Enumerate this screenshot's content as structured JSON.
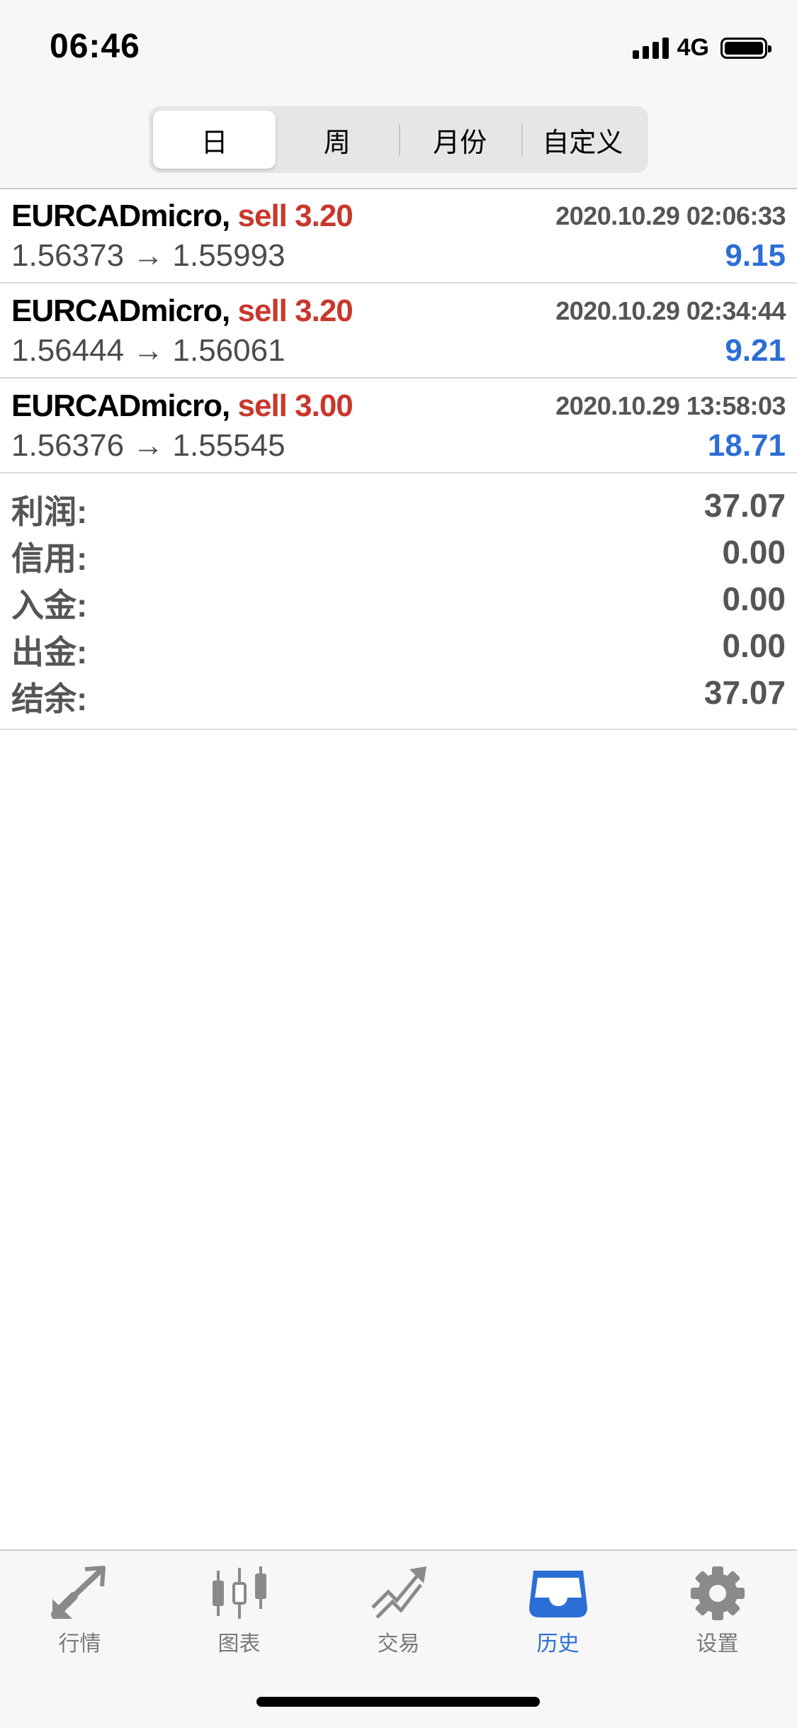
{
  "status": {
    "time": "06:46",
    "network": "4G"
  },
  "segments": [
    {
      "label": "日",
      "active": true
    },
    {
      "label": "周",
      "active": false
    },
    {
      "label": "月份",
      "active": false
    },
    {
      "label": "自定义",
      "active": false
    }
  ],
  "trades": [
    {
      "symbol": "EURCADmicro,",
      "action": "sell 3.20",
      "datetime": "2020.10.29 02:06:33",
      "prices": "1.56373 → 1.55993",
      "profit": "9.15"
    },
    {
      "symbol": "EURCADmicro,",
      "action": "sell 3.20",
      "datetime": "2020.10.29 02:34:44",
      "prices": "1.56444 → 1.56061",
      "profit": "9.21"
    },
    {
      "symbol": "EURCADmicro,",
      "action": "sell 3.00",
      "datetime": "2020.10.29 13:58:03",
      "prices": "1.56376 → 1.55545",
      "profit": "18.71"
    }
  ],
  "summary": [
    {
      "label": "利润:",
      "value": "37.07"
    },
    {
      "label": "信用:",
      "value": "0.00"
    },
    {
      "label": "入金:",
      "value": "0.00"
    },
    {
      "label": "出金:",
      "value": "0.00"
    },
    {
      "label": "结余:",
      "value": "37.07"
    }
  ],
  "tabs": [
    {
      "label": "行情",
      "icon": "quotes-arrows-icon",
      "active": false
    },
    {
      "label": "图表",
      "icon": "candlestick-chart-icon",
      "active": false
    },
    {
      "label": "交易",
      "icon": "trade-trend-icon",
      "active": false
    },
    {
      "label": "历史",
      "icon": "history-inbox-icon",
      "active": true
    },
    {
      "label": "设置",
      "icon": "gear-icon",
      "active": false
    }
  ],
  "colors": {
    "sell": "#c9372c",
    "profit": "#2b6fd6",
    "active_tab": "#2b6fd6",
    "inactive_tab": "#7a7a7a"
  }
}
